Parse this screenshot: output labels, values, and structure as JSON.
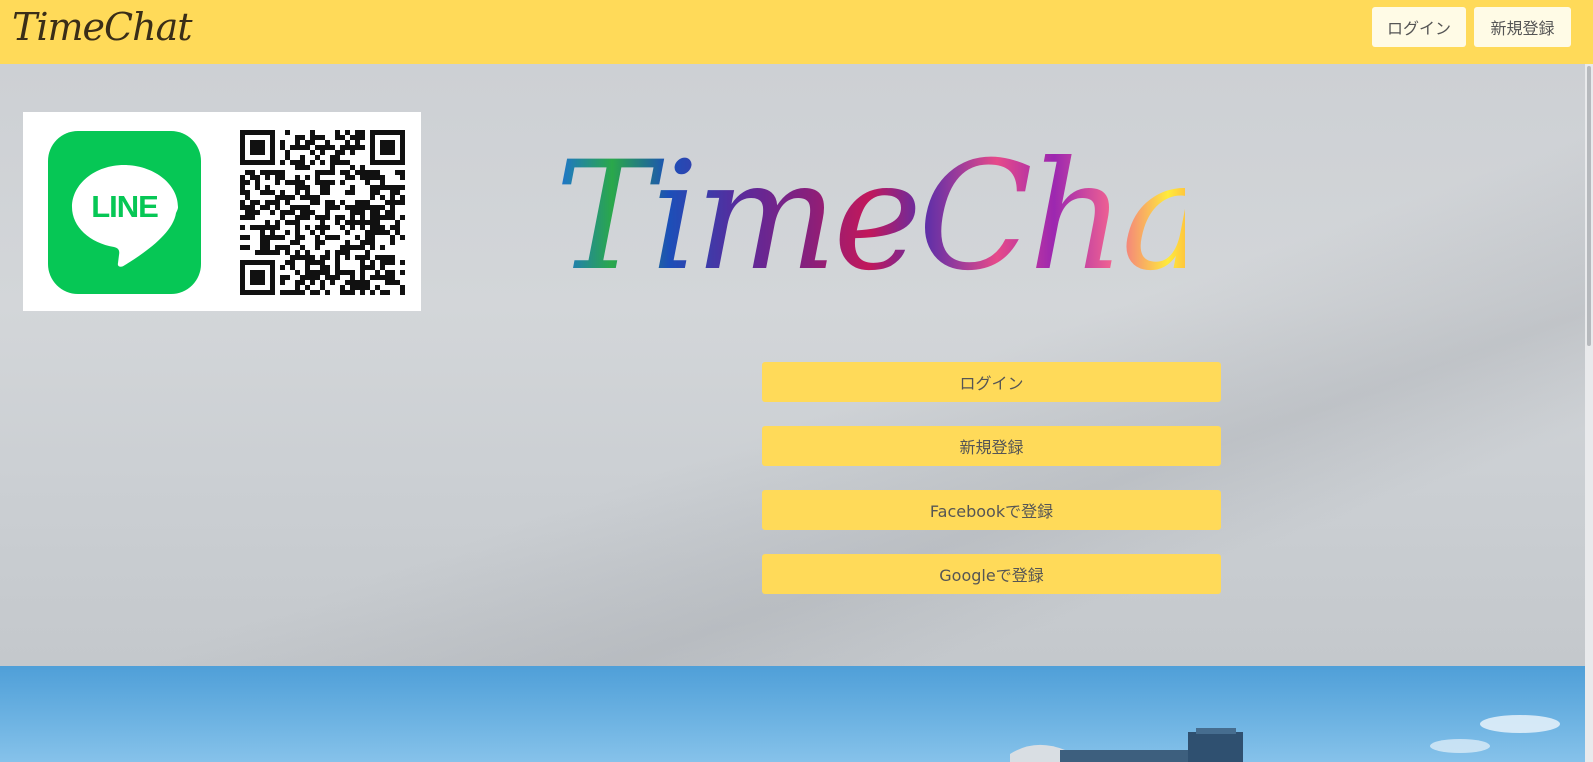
{
  "navbar": {
    "brand": "TimeChat",
    "login_label": "ログイン",
    "signup_label": "新規登録",
    "background": "#ffda59"
  },
  "line_card": {
    "logo_text": "LINE",
    "logo_color": "#06c755"
  },
  "hero": {
    "logo_text": "TimeChat"
  },
  "actions": {
    "login_label": "ログイン",
    "signup_label": "新規登録",
    "facebook_label": "Facebookで登録",
    "google_label": "Googleで登録"
  }
}
